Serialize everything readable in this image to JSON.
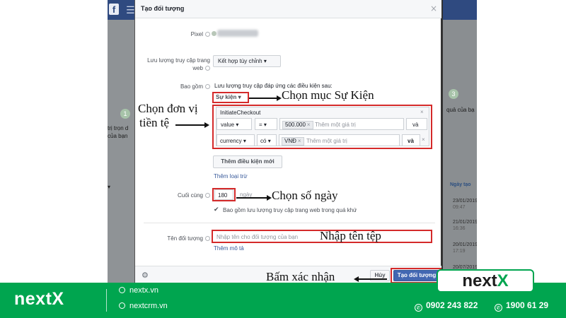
{
  "colors": {
    "brand_green": "#00a54f",
    "annotation_red": "#d42a2a",
    "fb_blue": "#4267b2",
    "link_blue": "#365899"
  },
  "background": {
    "step1": "1",
    "left_text_lines": [
      "trị trọn d",
      "của bạn"
    ],
    "step3": "3",
    "right_text": "quả của bạ",
    "column_header": "Ngày tạo",
    "dates": [
      {
        "date": "23/01/2019",
        "time": "09:47"
      },
      {
        "date": "21/01/2019",
        "time": "16:36"
      },
      {
        "date": "20/01/2019",
        "time": "17:19"
      },
      {
        "date": "20/07/2019",
        "time": ""
      }
    ]
  },
  "dialog": {
    "title": "Tạo đối tượng",
    "close_icon": "close-icon",
    "pixel_label": "Pixel",
    "traffic_label": "Lưu lượng truy cập trang web",
    "traffic_value": "Kết hợp tùy chỉnh",
    "include_label": "Bao gồm",
    "include_desc": "Lưu lượng truy cập đáp ứng các điều kiện sau:",
    "event_selector": "Sự kiện",
    "event_name": "InitiateCheckout",
    "rule1": {
      "param": "value",
      "operator": "=",
      "value": "500.000",
      "placeholder": "Thêm một giá trị",
      "join": "và"
    },
    "rule2": {
      "param": "currency",
      "operator": "có",
      "value": "VNĐ",
      "placeholder": "Thêm một giá trị",
      "join": "và"
    },
    "add_condition": "Thêm điều kiện mới",
    "add_exclusion": "Thêm loại trừ",
    "last_label": "Cuối cùng",
    "days_value": "180",
    "days_unit": "ngày",
    "checkbox_label": "Bao gồm lưu lượng truy cập trang web trong quá khứ",
    "name_label": "Tên đối tượng",
    "name_placeholder": "Nhập tên cho đối tượng của bạn",
    "add_description": "Thêm mô tả",
    "cancel": "Hủy",
    "create": "Tạo đối tượng"
  },
  "annotations": {
    "choose_event": "Chọn mục Sự Kiện",
    "choose_currency_l1": "Chọn đơn vị",
    "choose_currency_l2": "tiền tệ",
    "choose_days": "Chọn số ngày",
    "enter_name": "Nhập tên tệp",
    "confirm": "Bấm xác nhận"
  },
  "banner": {
    "brand_left": "nextX",
    "site1": "nextx.vn",
    "site2": "nextcrm.vn",
    "phone1": "0902 243 822",
    "phone2": "1900 61 29",
    "logo_next": "next",
    "logo_x": "X"
  }
}
